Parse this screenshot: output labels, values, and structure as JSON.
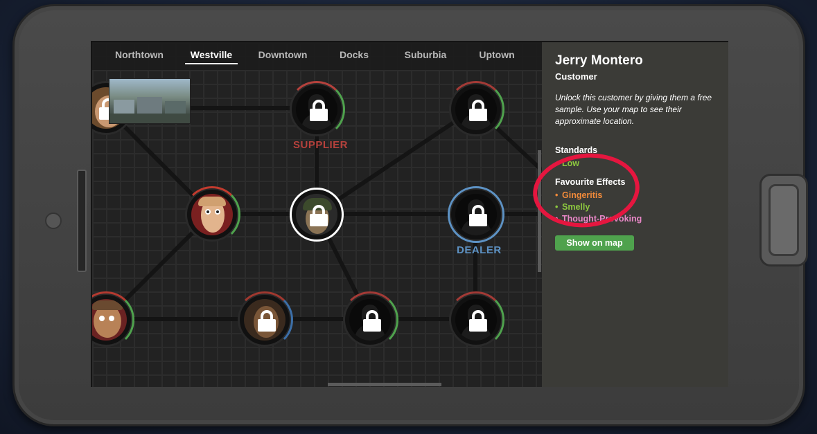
{
  "tabs": [
    "Northtown",
    "Westville",
    "Downtown",
    "Docks",
    "Suburbia",
    "Uptown"
  ],
  "active_tab": "Westville",
  "map_labels": {
    "supplier": "SUPPLIER",
    "dealer": "DEALER"
  },
  "panel": {
    "name": "Jerry Montero",
    "role": "Customer",
    "description": "Unlock this customer by giving them a free sample. Use your map to see their approximate location.",
    "standards_heading": "Standards",
    "standards_value": "Low",
    "effects_heading": "Favourite Effects",
    "effects": [
      {
        "label": "Gingeritis",
        "color": "#f08a3a"
      },
      {
        "label": "Smelly",
        "color": "#8cc63f"
      },
      {
        "label": "Thought-Provoking",
        "color": "#e887c7"
      }
    ],
    "show_on_map": "Show on map"
  },
  "colors": {
    "supplier": "#b5413c",
    "dealer": "#5d92c4",
    "button": "#4fa24d",
    "highlight": "#e5163f"
  }
}
